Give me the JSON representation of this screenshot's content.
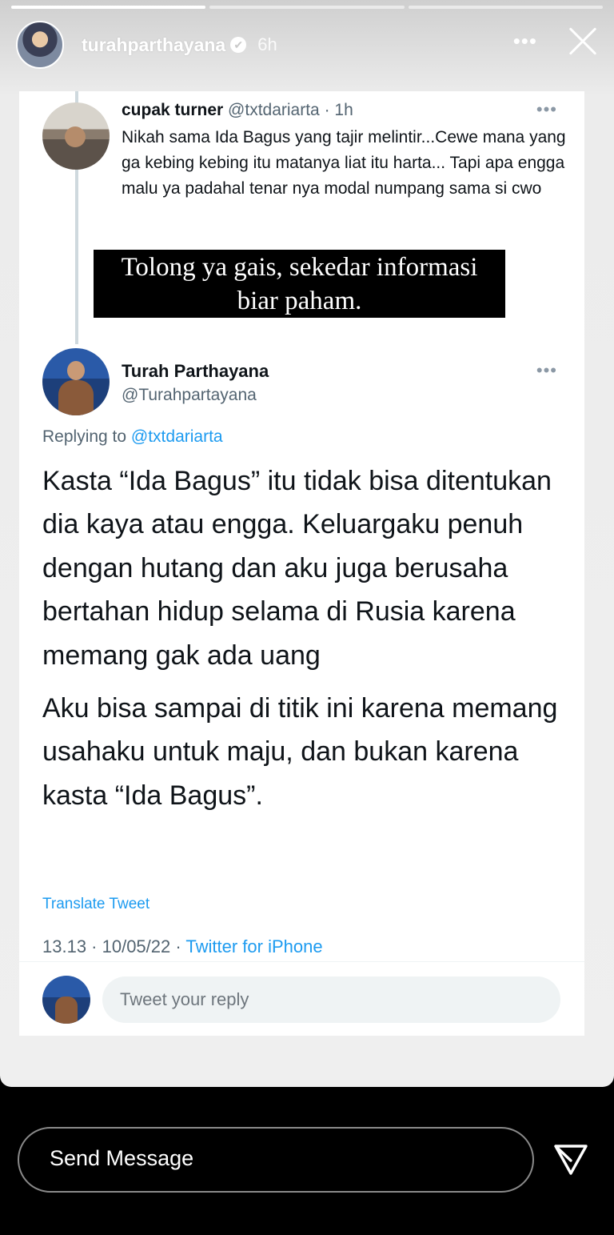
{
  "story": {
    "username": "turahparthayana",
    "time": "6h",
    "progress_done": 1,
    "progress_total": 3,
    "more_label": "•••"
  },
  "tweet_quoted": {
    "name": "cupak turner",
    "handle": "@txtdariarta",
    "time": "· 1h",
    "more_label": "•••",
    "text": "Nikah sama Ida Bagus yang tajir melintir...Cewe mana yang ga kebing kebing itu matanya liat itu harta... Tapi apa engga malu ya padahal tenar nya modal numpang sama si cwo"
  },
  "caption": {
    "line1": "Tolong ya gais, sekedar informasi",
    "line2": "biar paham."
  },
  "tweet_main": {
    "name": "Turah Parthayana",
    "handle": "@Turahpartayana",
    "more_label": "•••",
    "replying_prefix": "Replying to ",
    "replying_mention": "@txtdariarta",
    "paragraph1": "Kasta “Ida Bagus” itu tidak bisa ditentukan dia kaya atau engga. Keluargaku penuh dengan hutang dan aku juga berusaha bertahan hidup selama di Rusia karena memang gak ada uang",
    "paragraph2": "Aku bisa sampai di titik ini karena memang usahaku untuk maju, dan bukan karena kasta “Ida Bagus”.",
    "translate": "Translate Tweet",
    "timestamp": "13.13 · 10/05/22 · ",
    "source": "Twitter for iPhone"
  },
  "reply": {
    "placeholder": "Tweet your reply"
  },
  "message": {
    "label": "Send Message"
  },
  "colors": {
    "twitter_blue": "#1d9bf0",
    "text_primary": "#0f1419",
    "text_secondary": "#536471"
  }
}
